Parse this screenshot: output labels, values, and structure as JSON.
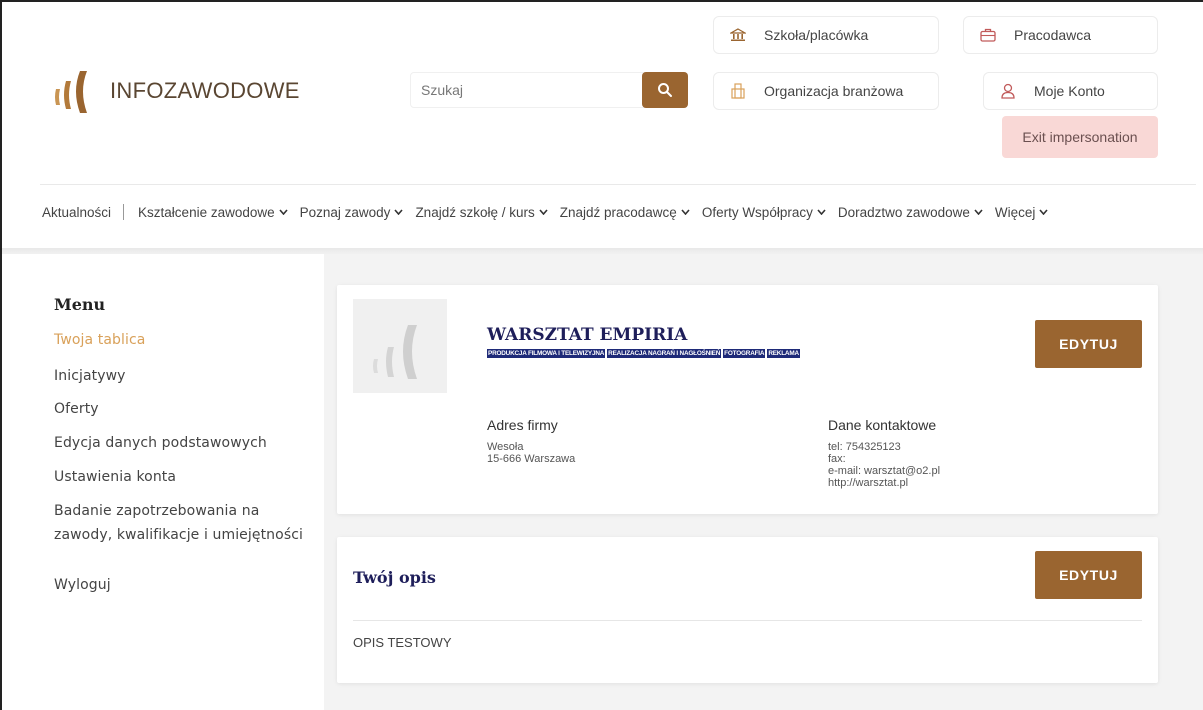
{
  "brand": {
    "name": "INFOZAWODOWE",
    "accent": "#9a6530",
    "link_active": "#d9a15a",
    "title_color": "#1e1e5a",
    "tag_bg": "#1e2a78"
  },
  "search": {
    "placeholder": "Szukaj"
  },
  "top_buttons": {
    "school": "Szkoła/placówka",
    "employer": "Pracodawca",
    "organization": "Organizacja branżowa",
    "account": "Moje Konto",
    "exit": "Exit impersonation"
  },
  "nav": {
    "items": [
      "Aktualności",
      "Kształcenie zawodowe",
      "Poznaj zawody",
      "Znajdź szkołę / kurs",
      "Znajdź pracodawcę",
      "Oferty Współpracy",
      "Doradztwo zawodowe",
      "Więcej"
    ]
  },
  "sidebar": {
    "title": "Menu",
    "items": [
      "Twoja tablica",
      "Inicjatywy",
      "Oferty",
      "Edycja danych podstawowych",
      "Ustawienia konta",
      "Badanie zapotrzebowania na",
      "zawody, kwalifikacje i umiejętności",
      "Wyloguj"
    ]
  },
  "company": {
    "name": "WARSZTAT EMPIRIA",
    "tags": [
      "PRODUKCJA FILMOWA I TELEWIZYJNA",
      "REALIZACJA NAGRAŃ I NAGŁOŚNIEŃ",
      "FOTOGRAFIA",
      "REKLAMA"
    ],
    "edit_label": "EDYTUJ",
    "address": {
      "heading": "Adres firmy",
      "line1": "Wesoła",
      "line2": "15-666 Warszawa"
    },
    "contact": {
      "heading": "Dane kontaktowe",
      "tel": "tel: 754325123",
      "fax": "fax:",
      "email": "e-mail: warsztat@o2.pl",
      "www": "http://warsztat.pl"
    }
  },
  "description": {
    "title": "Twój opis",
    "edit_label": "EDYTUJ",
    "text": "OPIS TESTOWY"
  }
}
